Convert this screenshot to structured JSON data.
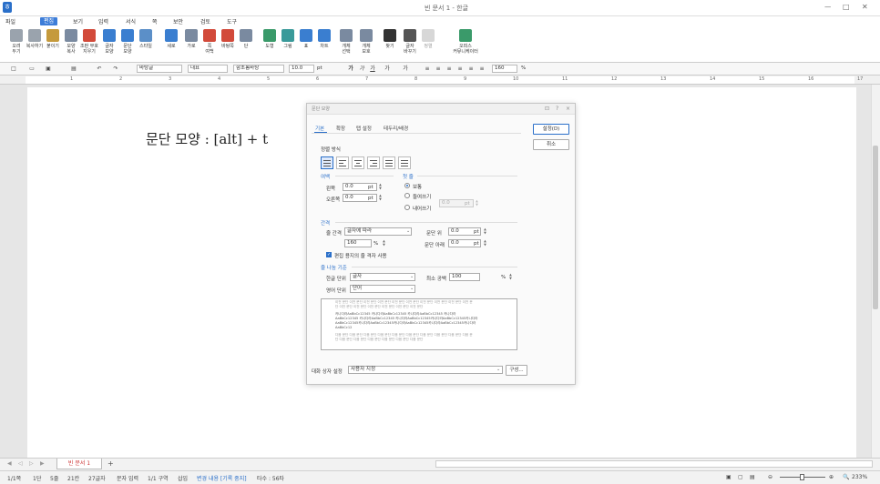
{
  "window": {
    "title": "빈 문서 1 - 한글",
    "controls": [
      "ㅡ",
      "□",
      "✕"
    ]
  },
  "menu": {
    "file": "파일",
    "edit": "편집",
    "view": "보기",
    "insert": "입력",
    "format": "서식",
    "page": "쪽",
    "security": "보안",
    "review": "검토",
    "tools": "도구"
  },
  "ribbon": [
    {
      "label1": "오려",
      "label2": "두기",
      "icon": "scissors-icon",
      "color": "#9aa3ad"
    },
    {
      "label1": "복사하기",
      "label2": "",
      "icon": "copy-icon",
      "color": "#9aa3ad"
    },
    {
      "label1": "붙이기",
      "label2": "",
      "icon": "paste-icon",
      "color": "#c59a3c"
    },
    {
      "label1": "모양",
      "label2": "복사",
      "icon": "format-painter-icon",
      "color": "#7a8aa0"
    },
    {
      "label1": "조판 부호",
      "label2": "지우기",
      "icon": "clear-format-icon",
      "color": "#d24a3a"
    },
    {
      "label1": "글자",
      "label2": "모양",
      "icon": "char-shape-icon",
      "color": "#3a7ed0"
    },
    {
      "label1": "문단",
      "label2": "모양",
      "icon": "para-shape-icon",
      "color": "#3a7ed0"
    },
    {
      "label1": "스타일",
      "label2": "",
      "icon": "style-icon",
      "color": "#5b8fc8"
    },
    {
      "label1": "세로",
      "label2": "",
      "icon": "vertical-icon",
      "color": "#3a7ed0"
    },
    {
      "label1": "가로",
      "label2": "",
      "icon": "horizontal-icon",
      "color": "#7a8aa0"
    },
    {
      "label1": "쪽",
      "label2": "여백",
      "icon": "page-margin-icon",
      "color": "#d24a3a"
    },
    {
      "label1": "바탕쪽",
      "label2": "",
      "icon": "master-page-icon",
      "color": "#d24a3a"
    },
    {
      "label1": "단",
      "label2": "",
      "icon": "column-icon",
      "color": "#7a8aa0"
    },
    {
      "label1": "도형",
      "label2": "",
      "icon": "shape-icon",
      "color": "#3a9a6a"
    },
    {
      "label1": "그림",
      "label2": "",
      "icon": "picture-icon",
      "color": "#3a9a9a"
    },
    {
      "label1": "표",
      "label2": "",
      "icon": "table-icon",
      "color": "#3a7ed0"
    },
    {
      "label1": "차트",
      "label2": "",
      "icon": "chart-icon",
      "color": "#3a7ed0"
    },
    {
      "label1": "개체",
      "label2": "선택",
      "icon": "object-select-icon",
      "color": "#7a8aa0"
    },
    {
      "label1": "개체",
      "label2": "보호",
      "icon": "object-protect-icon",
      "color": "#7a8aa0"
    },
    {
      "label1": "찾기",
      "label2": "",
      "icon": "find-icon",
      "color": "#333333"
    },
    {
      "label1": "글자",
      "label2": "바꾸기",
      "icon": "replace-icon",
      "color": "#555555"
    },
    {
      "label1": "정렬",
      "label2": "",
      "icon": "sort-icon",
      "color": "#b0b0b0"
    },
    {
      "label1": "오피스",
      "label2": "커뮤니케이터",
      "icon": "communicator-icon",
      "color": "#3a9a6a"
    }
  ],
  "format_bar": {
    "style": "바탕글",
    "lang": "대표",
    "font": "함초롬바탕",
    "size": "10.0",
    "size_unit": "pt",
    "zoom": "160",
    "zoom_unit": "%"
  },
  "ruler_numbers": [
    "1",
    "2",
    "3",
    "4",
    "5",
    "6",
    "7",
    "8",
    "9",
    "10",
    "11",
    "12",
    "13",
    "14",
    "15",
    "16",
    "17"
  ],
  "document": {
    "text": "문단 모양 : [alt] + t"
  },
  "tabs": {
    "doc": "빈 문서 1",
    "add": "+"
  },
  "status": {
    "page": "1/1쪽",
    "section": "1단",
    "line": "5줄",
    "col": "21칸",
    "chars": "27글자",
    "mode": "문자 입력",
    "area": "1/1 구역",
    "insert": "삽입",
    "track": "변경 내용 [기록 중지]",
    "lang": "타수 : 56타",
    "zoom": "233%"
  },
  "dialog": {
    "title": "문단 모양",
    "tabs": [
      "기본",
      "확장",
      "탭 설정",
      "테두리/배경"
    ],
    "set_button": "설정(D)",
    "cancel_button": "취소",
    "align_section": "정렬 방식",
    "margin_section": "여백",
    "left_label": "왼쪽",
    "left_value": "0.0",
    "right_label": "오른쪽",
    "right_value": "0.0",
    "unit_pt": "pt",
    "first_line_section": "첫 줄",
    "normal": "보통",
    "indent": "들여쓰기",
    "outdent": "내어쓰기",
    "indent_value": "0.0",
    "spacing_section": "간격",
    "line_spacing_label": "줄 간격",
    "line_spacing_type": "글자에 따라",
    "line_spacing_value": "160",
    "unit_percent": "%",
    "para_above_label": "문단 위",
    "para_above_value": "0.0",
    "para_below_label": "문단 아래",
    "para_below_value": "0.0",
    "grid_checkbox": "편집 용지의 줄 격자 사용",
    "break_section": "줄 나눔 기준",
    "hangul_label": "한글 단위",
    "hangul_value": "글자",
    "english_label": "영어 단위",
    "english_value": "단어",
    "min_space_label": "최소 공백",
    "min_space_value": "100",
    "preview_lines": [
      "이전 문단 이전 문단 이전 문단 이전 문단 이전 문단 이전 문단 이전 문단 이전 문단 이전 문단 이전 문",
      "단 이전 문단 이전 문단 이전 문단 이전 문단 이전 문단 이전 문단",
      "카나다라AaBbCc12345     카나다라AaBbCc12345     카나다라AaBbCc12345     카나다라",
      "AaBbCc12345  카나다라AaBbCc12345  카나다라AaBbCc12345카나다라AaBbCc12345카나다라",
      "AaBbCc12345카나다라AaBbCc12345카나다라AaBbCc12345카나다라AaBbCc12345카나다라",
      "AaBbCc12",
      "다음 문단 다음 문단 다음 문단 다음 문단 다음 문단 다음 문단 다음 문단 다음 문단 다음 문단 다음 문",
      "단 다음 문단 다음 문단 다음 문단 다음 문단 다음 문단 다음 문단"
    ],
    "dialog_setting_label": "대화 상자 설정",
    "dialog_setting_value": "사용자 지정",
    "configure_button": "구성..."
  }
}
